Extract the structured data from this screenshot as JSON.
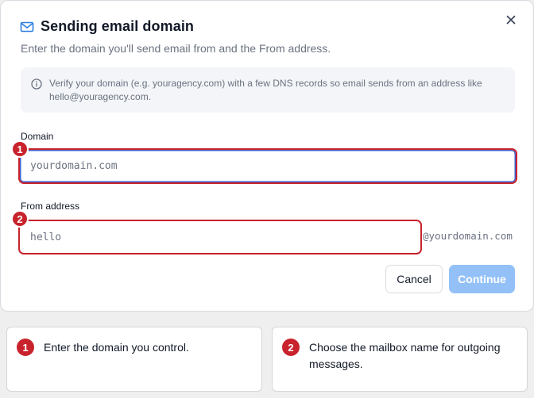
{
  "modal": {
    "title": "Sending email domain",
    "subtitle": "Enter the domain you'll send email from and the From address.",
    "info": "Verify your domain (e.g. youragency.com) with a few DNS records so email sends from an address like hello@youragency.com.",
    "icons": {
      "title_icon": "mail-icon",
      "close_icon": "close-icon",
      "info_icon": "info-circle-icon"
    }
  },
  "form": {
    "domain": {
      "label": "Domain",
      "placeholder": "yourdomain.com",
      "value": ""
    },
    "from": {
      "label": "From address",
      "placeholder": "hello",
      "value": "",
      "suffix": "@yourdomain.com"
    }
  },
  "actions": {
    "cancel": "Cancel",
    "continue": "Continue"
  },
  "annotations": [
    {
      "number": "1",
      "text": "Enter the domain you control."
    },
    {
      "number": "2",
      "text": "Choose the mailbox name for outgoing messages."
    }
  ],
  "colors": {
    "accent_blue": "#2b7de0",
    "callout_red": "#c8232c",
    "continue_disabled": "#93c1f7"
  }
}
